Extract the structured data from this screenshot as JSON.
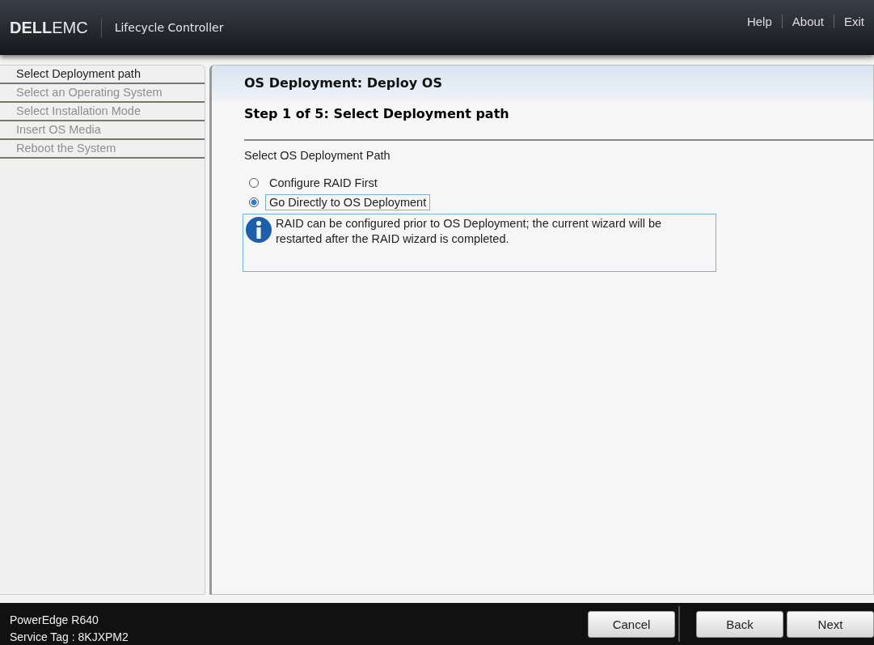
{
  "header": {
    "logo_bold": "DELL",
    "logo_light": "EMC",
    "product": "Lifecycle Controller",
    "links": [
      "Help",
      "About",
      "Exit"
    ]
  },
  "sidebar": {
    "steps": [
      {
        "label": "Select Deployment path",
        "selected": true
      },
      {
        "label": "Select an Operating System",
        "selected": false
      },
      {
        "label": "Select Installation Mode",
        "selected": false
      },
      {
        "label": "Insert OS Media",
        "selected": false
      },
      {
        "label": "Reboot the System",
        "selected": false
      }
    ]
  },
  "main": {
    "title": "OS Deployment: Deploy OS",
    "step_title": "Step 1 of 5: Select Deployment path",
    "section_label": "Select OS Deployment Path",
    "options": [
      {
        "label": "Configure RAID First",
        "selected": false
      },
      {
        "label": "Go Directly to OS Deployment",
        "selected": true
      }
    ],
    "info": "RAID can be configured prior to OS Deployment; the current wizard will be restarted after the RAID wizard is completed."
  },
  "footer": {
    "model": "PowerEdge R640",
    "service_tag": "Service Tag : 8KJXPM2",
    "buttons": [
      "Cancel",
      "Back",
      "Next"
    ]
  }
}
